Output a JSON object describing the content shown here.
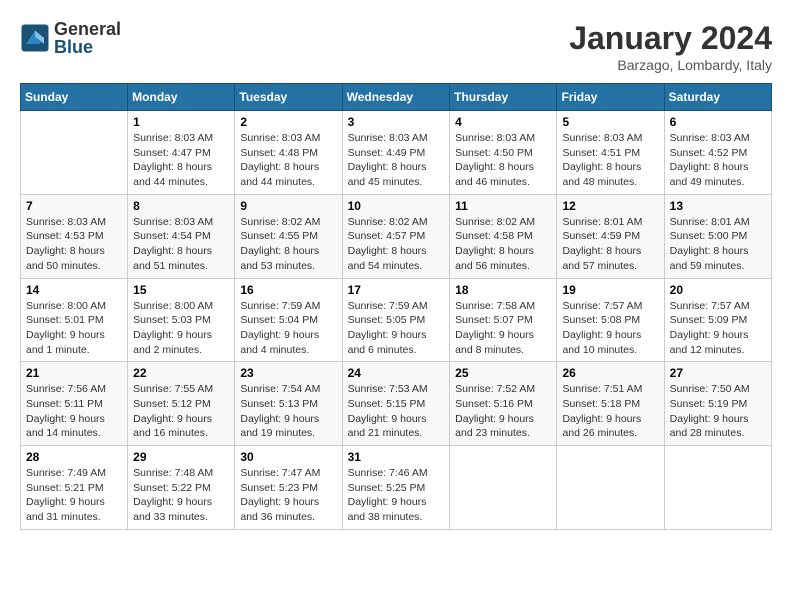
{
  "logo": {
    "general": "General",
    "blue": "Blue"
  },
  "header": {
    "month": "January 2024",
    "location": "Barzago, Lombardy, Italy"
  },
  "weekdays": [
    "Sunday",
    "Monday",
    "Tuesday",
    "Wednesday",
    "Thursday",
    "Friday",
    "Saturday"
  ],
  "weeks": [
    [
      {
        "day": "",
        "info": ""
      },
      {
        "day": "1",
        "info": "Sunrise: 8:03 AM\nSunset: 4:47 PM\nDaylight: 8 hours\nand 44 minutes."
      },
      {
        "day": "2",
        "info": "Sunrise: 8:03 AM\nSunset: 4:48 PM\nDaylight: 8 hours\nand 44 minutes."
      },
      {
        "day": "3",
        "info": "Sunrise: 8:03 AM\nSunset: 4:49 PM\nDaylight: 8 hours\nand 45 minutes."
      },
      {
        "day": "4",
        "info": "Sunrise: 8:03 AM\nSunset: 4:50 PM\nDaylight: 8 hours\nand 46 minutes."
      },
      {
        "day": "5",
        "info": "Sunrise: 8:03 AM\nSunset: 4:51 PM\nDaylight: 8 hours\nand 48 minutes."
      },
      {
        "day": "6",
        "info": "Sunrise: 8:03 AM\nSunset: 4:52 PM\nDaylight: 8 hours\nand 49 minutes."
      }
    ],
    [
      {
        "day": "7",
        "info": "Sunrise: 8:03 AM\nSunset: 4:53 PM\nDaylight: 8 hours\nand 50 minutes."
      },
      {
        "day": "8",
        "info": "Sunrise: 8:03 AM\nSunset: 4:54 PM\nDaylight: 8 hours\nand 51 minutes."
      },
      {
        "day": "9",
        "info": "Sunrise: 8:02 AM\nSunset: 4:55 PM\nDaylight: 8 hours\nand 53 minutes."
      },
      {
        "day": "10",
        "info": "Sunrise: 8:02 AM\nSunset: 4:57 PM\nDaylight: 8 hours\nand 54 minutes."
      },
      {
        "day": "11",
        "info": "Sunrise: 8:02 AM\nSunset: 4:58 PM\nDaylight: 8 hours\nand 56 minutes."
      },
      {
        "day": "12",
        "info": "Sunrise: 8:01 AM\nSunset: 4:59 PM\nDaylight: 8 hours\nand 57 minutes."
      },
      {
        "day": "13",
        "info": "Sunrise: 8:01 AM\nSunset: 5:00 PM\nDaylight: 8 hours\nand 59 minutes."
      }
    ],
    [
      {
        "day": "14",
        "info": "Sunrise: 8:00 AM\nSunset: 5:01 PM\nDaylight: 9 hours\nand 1 minute."
      },
      {
        "day": "15",
        "info": "Sunrise: 8:00 AM\nSunset: 5:03 PM\nDaylight: 9 hours\nand 2 minutes."
      },
      {
        "day": "16",
        "info": "Sunrise: 7:59 AM\nSunset: 5:04 PM\nDaylight: 9 hours\nand 4 minutes."
      },
      {
        "day": "17",
        "info": "Sunrise: 7:59 AM\nSunset: 5:05 PM\nDaylight: 9 hours\nand 6 minutes."
      },
      {
        "day": "18",
        "info": "Sunrise: 7:58 AM\nSunset: 5:07 PM\nDaylight: 9 hours\nand 8 minutes."
      },
      {
        "day": "19",
        "info": "Sunrise: 7:57 AM\nSunset: 5:08 PM\nDaylight: 9 hours\nand 10 minutes."
      },
      {
        "day": "20",
        "info": "Sunrise: 7:57 AM\nSunset: 5:09 PM\nDaylight: 9 hours\nand 12 minutes."
      }
    ],
    [
      {
        "day": "21",
        "info": "Sunrise: 7:56 AM\nSunset: 5:11 PM\nDaylight: 9 hours\nand 14 minutes."
      },
      {
        "day": "22",
        "info": "Sunrise: 7:55 AM\nSunset: 5:12 PM\nDaylight: 9 hours\nand 16 minutes."
      },
      {
        "day": "23",
        "info": "Sunrise: 7:54 AM\nSunset: 5:13 PM\nDaylight: 9 hours\nand 19 minutes."
      },
      {
        "day": "24",
        "info": "Sunrise: 7:53 AM\nSunset: 5:15 PM\nDaylight: 9 hours\nand 21 minutes."
      },
      {
        "day": "25",
        "info": "Sunrise: 7:52 AM\nSunset: 5:16 PM\nDaylight: 9 hours\nand 23 minutes."
      },
      {
        "day": "26",
        "info": "Sunrise: 7:51 AM\nSunset: 5:18 PM\nDaylight: 9 hours\nand 26 minutes."
      },
      {
        "day": "27",
        "info": "Sunrise: 7:50 AM\nSunset: 5:19 PM\nDaylight: 9 hours\nand 28 minutes."
      }
    ],
    [
      {
        "day": "28",
        "info": "Sunrise: 7:49 AM\nSunset: 5:21 PM\nDaylight: 9 hours\nand 31 minutes."
      },
      {
        "day": "29",
        "info": "Sunrise: 7:48 AM\nSunset: 5:22 PM\nDaylight: 9 hours\nand 33 minutes."
      },
      {
        "day": "30",
        "info": "Sunrise: 7:47 AM\nSunset: 5:23 PM\nDaylight: 9 hours\nand 36 minutes."
      },
      {
        "day": "31",
        "info": "Sunrise: 7:46 AM\nSunset: 5:25 PM\nDaylight: 9 hours\nand 38 minutes."
      },
      {
        "day": "",
        "info": ""
      },
      {
        "day": "",
        "info": ""
      },
      {
        "day": "",
        "info": ""
      }
    ]
  ]
}
